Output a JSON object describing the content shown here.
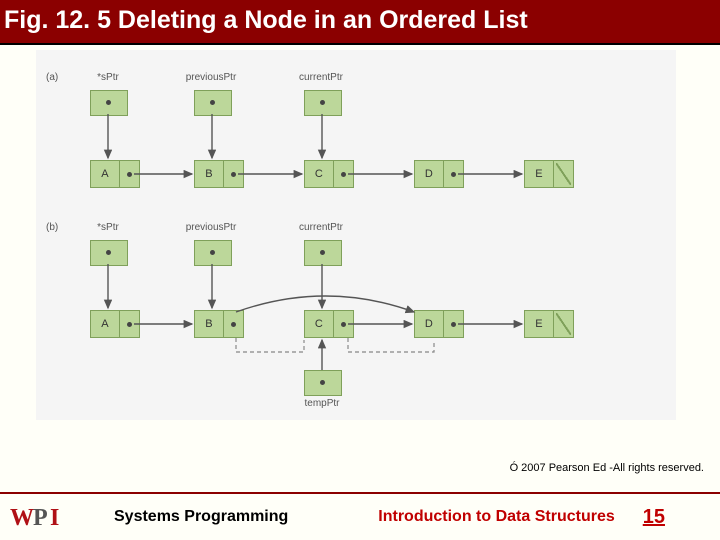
{
  "title": "Fig. 12. 5 Deleting a Node in an Ordered List",
  "copyright": "Ó 2007 Pearson Ed -All rights reserved.",
  "footer": {
    "left": "Systems Programming",
    "center": "Introduction to Data Structures",
    "page": "15"
  },
  "diagram": {
    "a": {
      "tag": "(a)",
      "pointers": {
        "s": "*sPtr",
        "prev": "previousPtr",
        "curr": "currentPtr"
      },
      "nodes": [
        "A",
        "B",
        "C",
        "D",
        "E"
      ]
    },
    "b": {
      "tag": "(b)",
      "pointers": {
        "s": "*sPtr",
        "prev": "previousPtr",
        "curr": "currentPtr"
      },
      "nodes": [
        "A",
        "B",
        "C",
        "D",
        "E"
      ],
      "temp": "tempPtr"
    }
  }
}
